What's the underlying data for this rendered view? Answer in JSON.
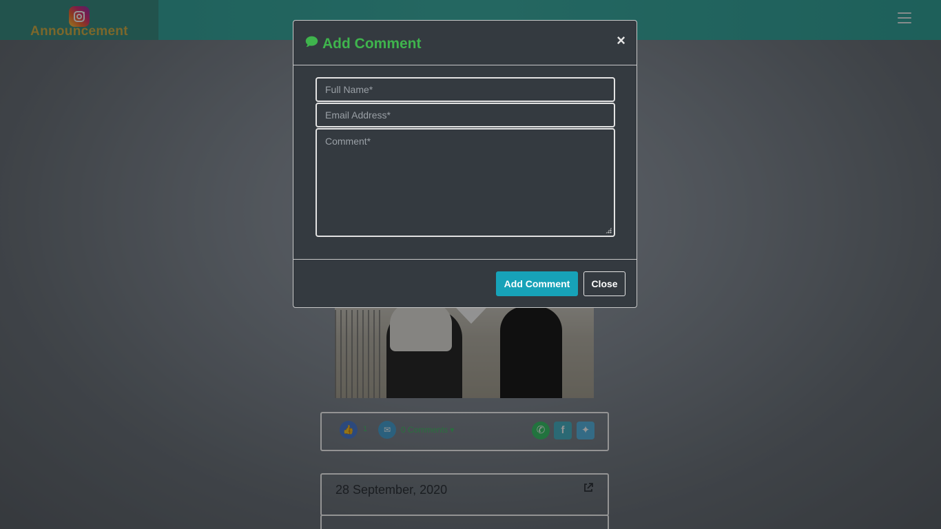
{
  "header": {
    "brand_text": "Announcement",
    "logo_icon": "instagram-logo",
    "menu_icon": "hamburger-menu-icon"
  },
  "post": {
    "like_count": "1",
    "comments_label": "0 Comments ▾",
    "share_icons": [
      "whatsapp-icon",
      "facebook-icon",
      "twitter-icon"
    ]
  },
  "next_post": {
    "date": "28 September, 2020"
  },
  "modal": {
    "title": "Add Comment",
    "close_symbol": "×",
    "fields": {
      "name_placeholder": "Full Name*",
      "email_placeholder": "Email Address*",
      "comment_placeholder": "Comment*"
    },
    "buttons": {
      "add_label": "Add Comment",
      "close_label": "Close"
    }
  },
  "colors": {
    "header_teal": "#3fb2a8",
    "brand_gold": "#d6b24a",
    "modal_bg": "#343a40",
    "title_green": "#3fb44d",
    "primary_button": "#17a2b8"
  }
}
